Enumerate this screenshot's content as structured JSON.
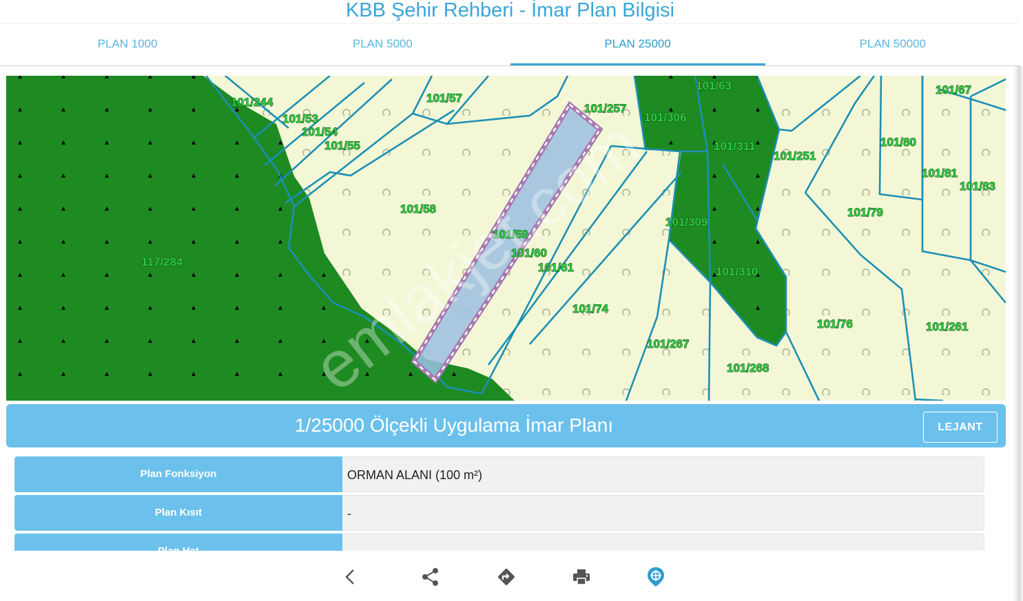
{
  "app": {
    "title": "KBB Şehir Rehberi - İmar Plan Bilgisi"
  },
  "tabs": [
    {
      "label": "PLAN 1000",
      "active": false
    },
    {
      "label": "PLAN 5000",
      "active": false
    },
    {
      "label": "PLAN 25000",
      "active": true
    },
    {
      "label": "PLAN 50000",
      "active": false
    }
  ],
  "map": {
    "watermark": "emlakjet.com",
    "parcels": [
      "101/244",
      "101/53",
      "101/54",
      "101/55",
      "101/57",
      "101/58",
      "117/284",
      "101/59",
      "101/60",
      "101/61",
      "101/74",
      "101/257",
      "101/306",
      "101/63",
      "101/311",
      "101/251",
      "101/309",
      "101/310",
      "101/267",
      "101/268",
      "101/67",
      "101/80",
      "101/81",
      "101/83",
      "101/79",
      "101/76",
      "101/261"
    ]
  },
  "plan": {
    "title": "1/25000 Ölçekli Uygulama İmar Planı",
    "legend_label": "LEJANT"
  },
  "info_rows": [
    {
      "label": "Plan Fonksiyon",
      "value": "ORMAN ALANI (100 m²)"
    },
    {
      "label": "Plan Kısıt",
      "value": "-"
    },
    {
      "label": "Plan Hat",
      "value": ""
    }
  ],
  "bottom_nav": [
    {
      "icon": "back-icon"
    },
    {
      "icon": "share-icon"
    },
    {
      "icon": "directions-icon"
    },
    {
      "icon": "print-icon"
    },
    {
      "icon": "location-icon"
    }
  ],
  "colors": {
    "accent": "#6cc1ec",
    "forest": "#1e8a22",
    "plain": "#f3f7d6",
    "parcel_line": "#1d8fb5",
    "selected_fill": "#9bc0e0",
    "selected_border": "#a77ab0"
  }
}
